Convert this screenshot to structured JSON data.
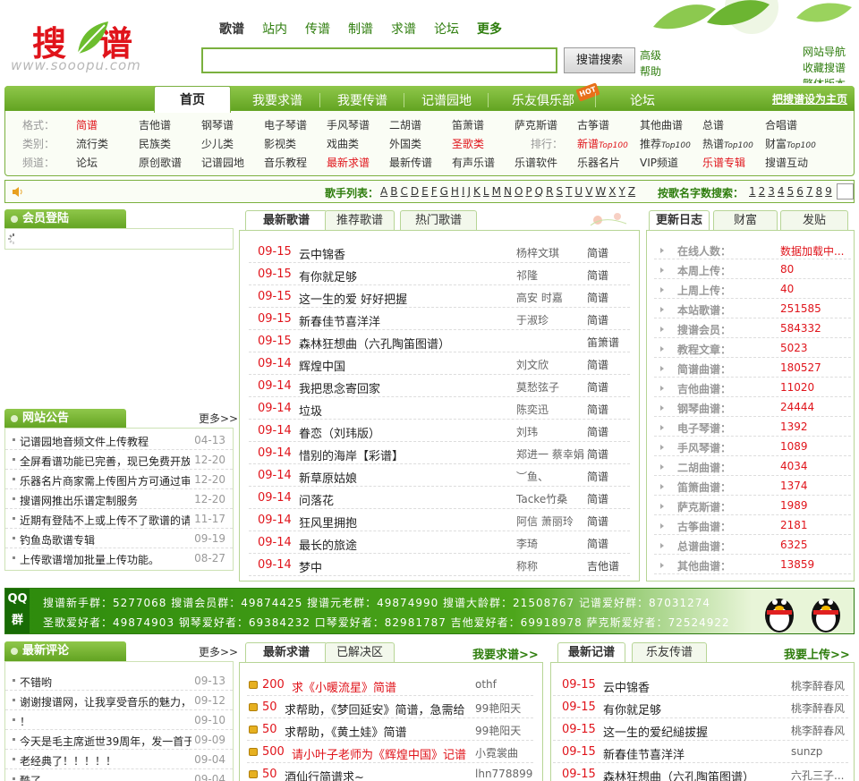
{
  "header": {
    "logo_text": "搜谱",
    "logo_url": "www.sooopu.com",
    "topnav": [
      "歌谱",
      "站内",
      "传谱",
      "制谱",
      "求谱",
      "论坛",
      "更多"
    ],
    "search_value": "",
    "search_button": "搜谱搜索",
    "advanced": "高级",
    "help": "帮助",
    "right_links": [
      "网站导航",
      "收藏搜谱",
      "繁体版本"
    ]
  },
  "mainnav": {
    "tabs": [
      "首页",
      "我要求谱",
      "我要传谱",
      "记谱园地",
      "乐友俱乐部",
      "论坛"
    ],
    "hot_badge": "HOT",
    "set_home": "把搜谱设为主页",
    "row1": {
      "label": "格式：",
      "items": [
        "简谱",
        "吉他谱",
        "钢琴谱",
        "电子琴谱",
        "手风琴谱",
        "二胡谱",
        "笛萧谱",
        "萨克斯谱",
        "古筝谱",
        "其他曲谱",
        "总谱",
        "合唱谱"
      ]
    },
    "row2": {
      "label": "类别：",
      "items": [
        "流行类",
        "民族类",
        "少儿类",
        "影视类",
        "戏曲类",
        "外国类",
        "圣歌类"
      ],
      "rank_label": "排行：",
      "rank_items": [
        "新谱",
        "推荐",
        "热谱",
        "财富"
      ],
      "top100": "Top100"
    },
    "row3": {
      "label": "频道：",
      "items": [
        "论坛",
        "原创歌谱",
        "记谱园地",
        "音乐教程",
        "最新求谱",
        "最新传谱",
        "有声乐谱",
        "乐谱软件",
        "乐器名片",
        "VIP频道",
        "乐谱专辑",
        "搜谱互动"
      ]
    }
  },
  "singerbar": {
    "label": "歌手列表：",
    "letters": [
      "A",
      "B",
      "C",
      "D",
      "E",
      "F",
      "G",
      "H",
      "I",
      "J",
      "K",
      "L",
      "M",
      "N",
      "O",
      "P",
      "Q",
      "R",
      "S",
      "T",
      "U",
      "V",
      "W",
      "X",
      "Y",
      "Z"
    ],
    "by_count_label": "按歌名字数搜索：",
    "numbers": [
      "1",
      "2",
      "3",
      "4",
      "5",
      "6",
      "7",
      "8",
      "9"
    ]
  },
  "member": {
    "title": "会员登陆"
  },
  "notices": {
    "title": "网站公告",
    "more": "更多>>",
    "items": [
      {
        "t": "记谱园地音频文件上传教程",
        "d": "04-13"
      },
      {
        "t": "全屏看谱功能已完善，现已免费开放",
        "d": "12-20"
      },
      {
        "t": "乐器名片商家需上传图片方可通过审",
        "d": "12-20"
      },
      {
        "t": "搜谱网推出乐谱定制服务",
        "d": "12-20"
      },
      {
        "t": "近期有登陆不上或上传不了歌谱的请",
        "d": "11-17"
      },
      {
        "t": "钓鱼岛歌谱专辑",
        "d": "09-19"
      },
      {
        "t": "上传歌谱增加批量上传功能。",
        "d": "08-27"
      }
    ]
  },
  "songs": {
    "tabs": [
      "最新歌谱",
      "推荐歌谱",
      "热门歌谱"
    ],
    "rows": [
      {
        "d": "09-15",
        "n": "云中锦香",
        "a": "杨梓文琪",
        "t": "简谱"
      },
      {
        "d": "09-15",
        "n": "有你就足够",
        "a": "祁隆",
        "t": "简谱"
      },
      {
        "d": "09-15",
        "n": "这一生的爱 好好把握",
        "a": "高安 时嘉",
        "t": "简谱"
      },
      {
        "d": "09-15",
        "n": "新春佳节喜洋洋",
        "a": "于淑珍",
        "t": "简谱"
      },
      {
        "d": "09-15",
        "n": "森林狂想曲（六孔陶笛图谱）",
        "a": "",
        "t": "笛箫谱"
      },
      {
        "d": "09-14",
        "n": "辉煌中国",
        "a": "刘文欣",
        "t": "简谱"
      },
      {
        "d": "09-14",
        "n": "我把思念寄回家",
        "a": "莫愁弦子",
        "t": "简谱"
      },
      {
        "d": "09-14",
        "n": "垃圾",
        "a": "陈奕迅",
        "t": "简谱"
      },
      {
        "d": "09-14",
        "n": "眷恋（刘玮版）",
        "a": "刘玮",
        "t": "简谱"
      },
      {
        "d": "09-14",
        "n": "惜别的海岸【彩谱】",
        "a": "郑进一 蔡幸娟",
        "t": "简谱"
      },
      {
        "d": "09-14",
        "n": "新草原姑娘",
        "a": "︶鱼、",
        "t": "简谱"
      },
      {
        "d": "09-14",
        "n": "问落花",
        "a": "Tacke竹桑",
        "t": "简谱"
      },
      {
        "d": "09-14",
        "n": "狂风里拥抱",
        "a": "阿信 萧丽玲",
        "t": "简谱"
      },
      {
        "d": "09-14",
        "n": "最长的旅途",
        "a": "李琦",
        "t": "简谱"
      },
      {
        "d": "09-14",
        "n": "梦中",
        "a": "称称",
        "t": "吉他谱"
      }
    ]
  },
  "updates": {
    "tabs": [
      "更新日志",
      "财富",
      "发贴"
    ],
    "rows": [
      {
        "k": "在线人数：",
        "v": "数据加载中..."
      },
      {
        "k": "本周上传：",
        "v": "80"
      },
      {
        "k": "上周上传：",
        "v": "40"
      },
      {
        "k": "本站歌谱：",
        "v": "251585"
      },
      {
        "k": "搜谱会员：",
        "v": "584332"
      },
      {
        "k": "教程文章：",
        "v": "5023"
      },
      {
        "k": "简谱曲谱：",
        "v": "180527"
      },
      {
        "k": "吉他曲谱：",
        "v": "11020"
      },
      {
        "k": "钢琴曲谱：",
        "v": "24444"
      },
      {
        "k": "电子琴谱：",
        "v": "1392"
      },
      {
        "k": "手风琴谱：",
        "v": "1089"
      },
      {
        "k": "二胡曲谱：",
        "v": "4034"
      },
      {
        "k": "笛箫曲谱：",
        "v": "1374"
      },
      {
        "k": "萨克斯谱：",
        "v": "1989"
      },
      {
        "k": "古筝曲谱：",
        "v": "2181"
      },
      {
        "k": "总谱曲谱：",
        "v": "6325"
      },
      {
        "k": "其他曲谱：",
        "v": "13859"
      }
    ]
  },
  "qq": {
    "label": "QQ群",
    "line1": "搜谱新手群：5277068   搜谱会员群：49874425   搜谱元老群：49874990   搜谱大龄群：21508767   记谱爱好群：87031274",
    "line2": "圣歌爱好者：49874903  钢琴爱好者：69384232  口琴爱好者：82981787  吉他爱好者：69918978  萨克斯爱好者：72524922"
  },
  "comments": {
    "title": "最新评论",
    "more": "更多>>",
    "items": [
      {
        "t": "不错哟",
        "d": "09-13"
      },
      {
        "t": "谢谢搜谱网，让我享受音乐的魅力，",
        "d": "09-12"
      },
      {
        "t": "！",
        "d": "09-10"
      },
      {
        "t": "今天是毛主席逝世39周年，发一首于",
        "d": "09-09"
      },
      {
        "t": "老经典了！！！！！",
        "d": "09-04"
      },
      {
        "t": "酷了",
        "d": "09-04"
      }
    ]
  },
  "requests": {
    "tabs": [
      "最新求谱",
      "已解决区"
    ],
    "action": "我要求谱>>",
    "rows": [
      {
        "p": "200",
        "t": "求《小暖流星》简谱",
        "u": "othf",
        "hl": true
      },
      {
        "p": "50",
        "t": "求帮助，《梦回延安》简谱，急需给",
        "u": "99艳阳天",
        "hl": false
      },
      {
        "p": "50",
        "t": "求帮助，《黄土娃》简谱",
        "u": "99艳阳天",
        "hl": false
      },
      {
        "p": "500",
        "t": "请小叶子老师为《辉煌中国》记谱",
        "u": "小霓裳曲",
        "hl": true
      },
      {
        "p": "50",
        "t": "酒仙行简谱求~",
        "u": "lhn778899",
        "hl": false
      }
    ]
  },
  "records": {
    "tabs": [
      "最新记谱",
      "乐友传谱"
    ],
    "action": "我要上传>>",
    "rows": [
      {
        "d": "09-15",
        "n": "云中锦香",
        "a": "桃李醉春风"
      },
      {
        "d": "09-15",
        "n": "有你就足够",
        "a": "桃李醉春风"
      },
      {
        "d": "09-15",
        "n": "这一生的爱纪縋拔握",
        "a": "桃李醉春风"
      },
      {
        "d": "09-15",
        "n": "新春佳节喜洋洋",
        "a": "sunzp"
      },
      {
        "d": "09-15",
        "n": "森林狂想曲（六孔陶笛图谱）",
        "a": "六孔三子..."
      }
    ]
  }
}
